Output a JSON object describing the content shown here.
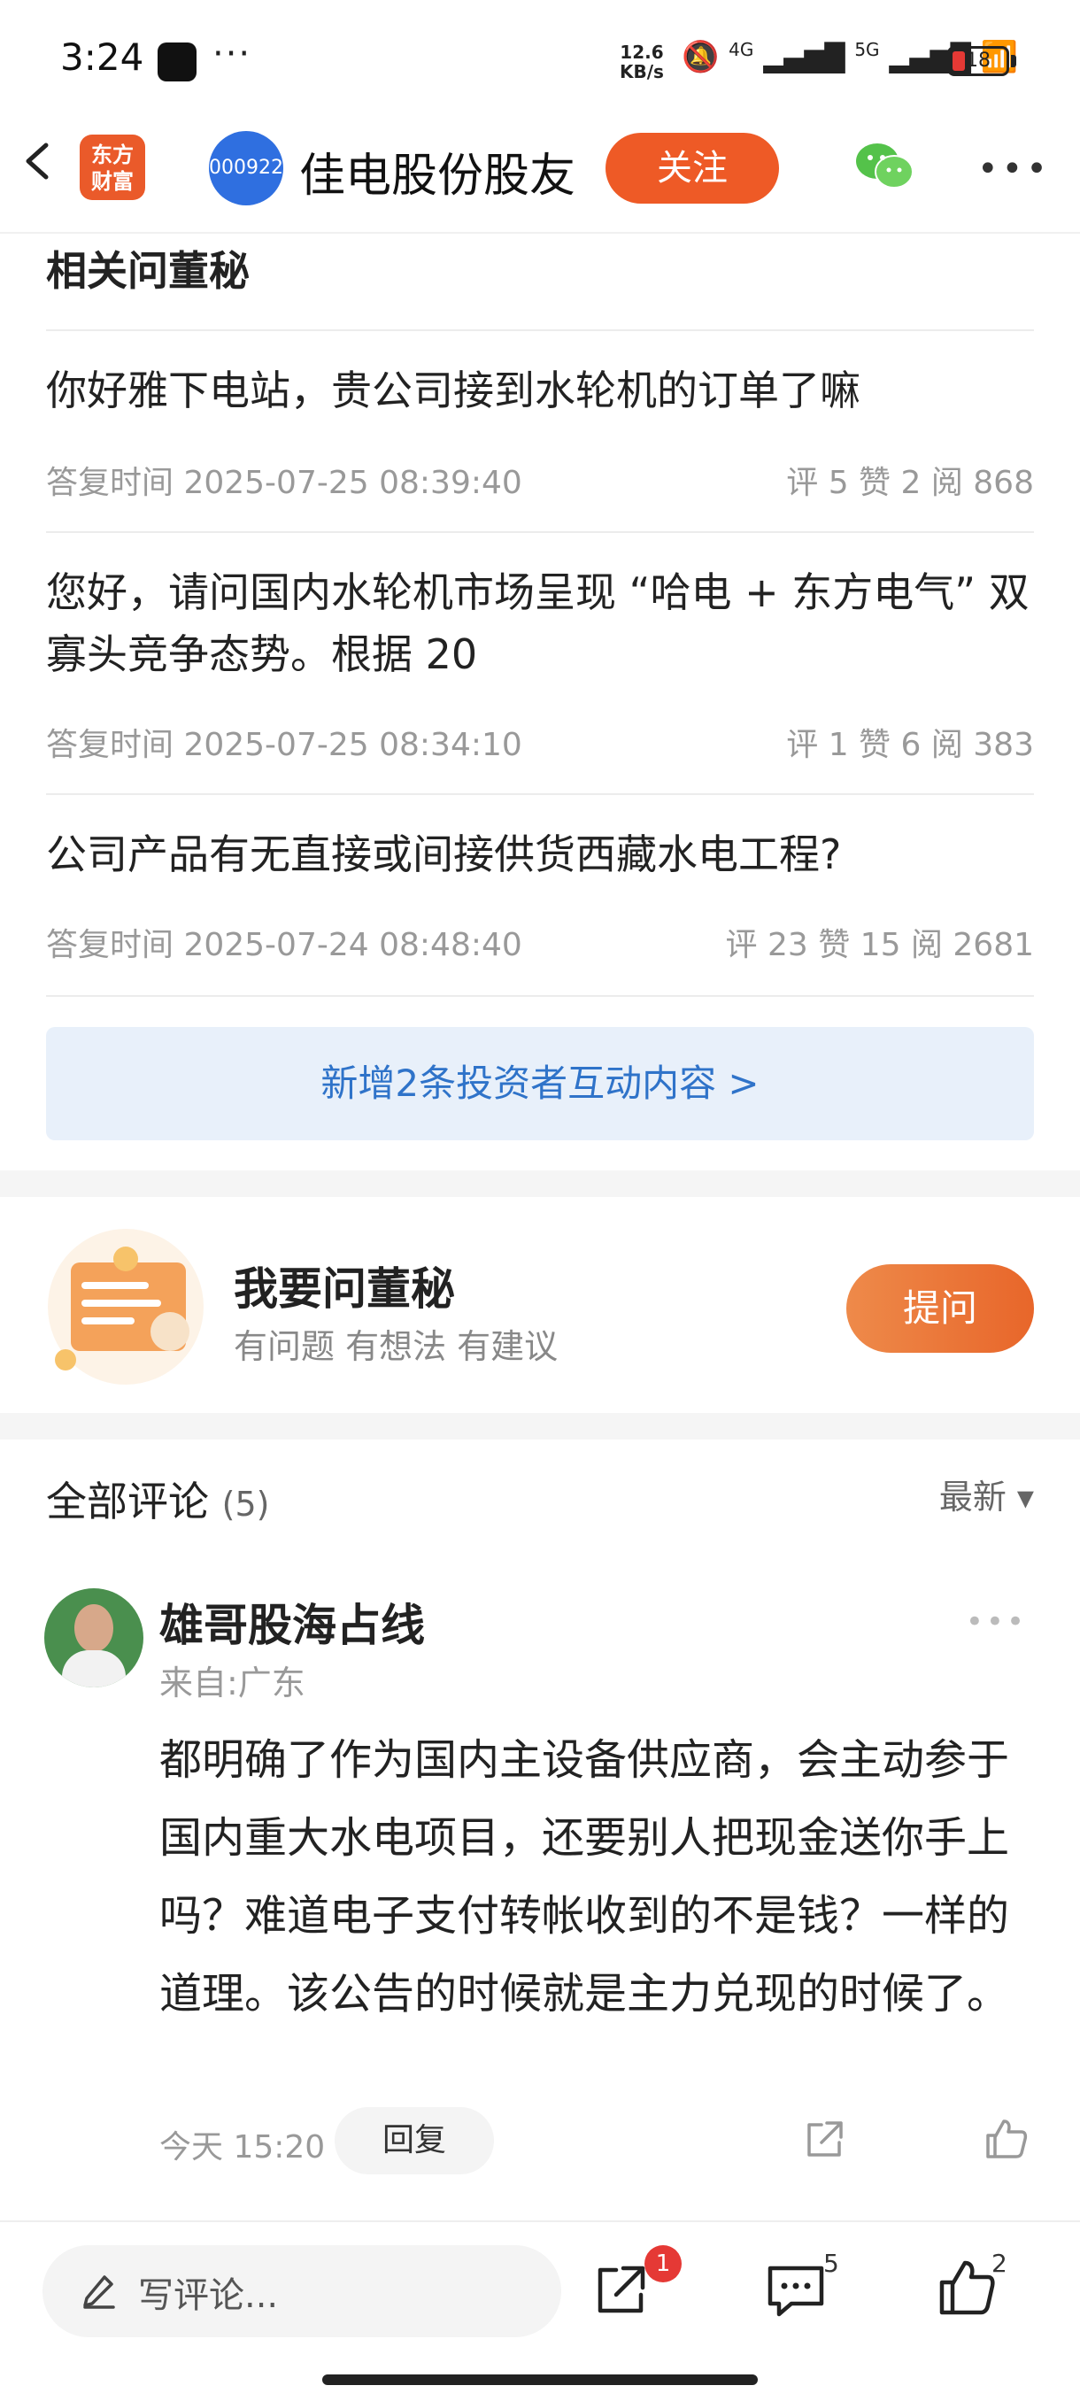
{
  "status_bar": {
    "time": "3:24",
    "more": "···",
    "net_speed": "12.6",
    "net_unit": "KB/s",
    "signal_4g": "4G",
    "signal_5g": "5G",
    "battery": "18"
  },
  "header": {
    "logo_line1": "东方",
    "logo_line2": "财富",
    "stock_code": "000922",
    "title": "佳电股份股友",
    "follow_label": "关注"
  },
  "qa_section": {
    "title": "相关问董秘",
    "items": [
      {
        "question": "你好雅下电站，贵公司接到水轮机的订单了嘛",
        "time": "答复时间 2025-07-25 08:39:40",
        "stats": "评 5  赞 2  阅 868"
      },
      {
        "question": "您好，请问国内水轮机市场呈现 “哈电 + 东方电气” 双寡头竞争态势。根据 20",
        "time": "答复时间 2025-07-25 08:34:10",
        "stats": "评 1  赞 6  阅 383"
      },
      {
        "question": "公司产品有无直接或间接供货西藏水电工程?",
        "time": "答复时间 2025-07-24 08:48:40",
        "stats": "评 23  赞 15  阅 2681"
      }
    ],
    "more_label": "新增2条投资者互动内容 >"
  },
  "ask": {
    "title": "我要问董秘",
    "subtitle": "有问题 有想法 有建议",
    "button_label": "提问"
  },
  "comments": {
    "title": "全部评论",
    "count": "(5)",
    "sort_label": "最新 ▾",
    "items": [
      {
        "author": "雄哥股海占线",
        "from": "来自:广东",
        "text": "都明确了作为国内主设备供应商，会主动参于国内重大水电项目，还要别人把现金送你手上吗？难道电子支付转帐收到的不是钱？一样的道理。该公告的时候就是主力兑现的时候了。",
        "time": "今天 15:20",
        "reply_label": "回复"
      }
    ]
  },
  "bottom_bar": {
    "write_placeholder": "写评论...",
    "share_badge": "1",
    "comment_count": "5",
    "like_count": "2"
  },
  "colors": {
    "accent": "#ee5a26",
    "link": "#2f73c9",
    "badge": "#e53935"
  }
}
